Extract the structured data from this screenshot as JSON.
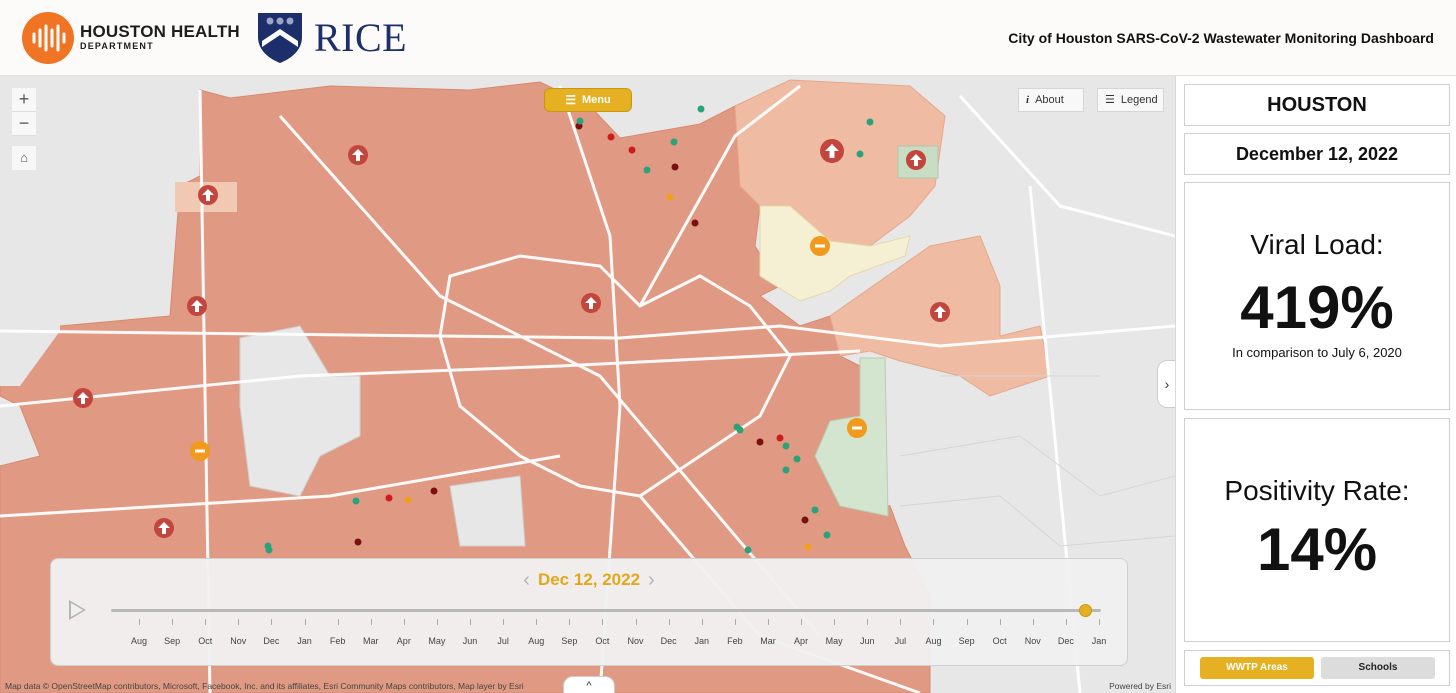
{
  "header": {
    "hhd_name": "HOUSTON HEALTH",
    "hhd_sub": "DEPARTMENT",
    "rice": "RICE",
    "title": "City of Houston SARS-CoV-2 Wastewater Monitoring Dashboard"
  },
  "map": {
    "zoom_in": "+",
    "zoom_out": "−",
    "home": "⌂",
    "menu_label": "Menu",
    "about_label": "About",
    "legend_label": "Legend",
    "expand": "›",
    "collapse": "^",
    "attribution": "Map data © OpenStreetMap contributors, Microsoft, Facebook, Inc. and its affiliates, Esri Community Maps contributors, Map layer by Esri",
    "powered_by": "Powered by Esri",
    "colors": {
      "high": "#e09a84",
      "medium": "#efbca3",
      "low": "#f5efd3",
      "decrease": "#d3e4cf",
      "increase_marker": "#c2463d",
      "steady_marker": "#f19a1c"
    }
  },
  "timeline": {
    "current_date": "Dec 12, 2022",
    "prev": "‹",
    "next": "›",
    "position": 0.985,
    "months": [
      "Aug",
      "Sep",
      "Oct",
      "Nov",
      "Dec",
      "Jan",
      "Feb",
      "Mar",
      "Apr",
      "May",
      "Jun",
      "Jul",
      "Aug",
      "Sep",
      "Oct",
      "Nov",
      "Dec",
      "Jan",
      "Feb",
      "Mar",
      "Apr",
      "May",
      "Jun",
      "Jul",
      "Aug",
      "Sep",
      "Oct",
      "Nov",
      "Dec",
      "Jan"
    ]
  },
  "panel": {
    "city": "HOUSTON",
    "date": "December 12, 2022",
    "viral_label": "Viral Load:",
    "viral_value": "419%",
    "viral_sub": "In comparison to July 6, 2020",
    "positivity_label": "Positivity Rate:",
    "positivity_value": "14%",
    "wwtp_button": "WWTP Areas",
    "schools_button": "Schools"
  }
}
